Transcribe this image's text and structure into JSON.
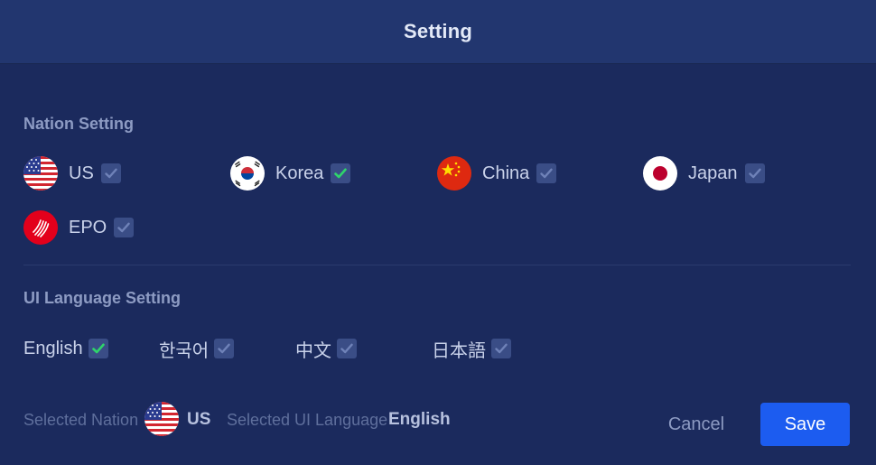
{
  "header": {
    "title": "Setting"
  },
  "nation_section": {
    "title": "Nation Setting",
    "items": [
      {
        "label": "US",
        "icon": "us-flag-icon",
        "checked": false
      },
      {
        "label": "Korea",
        "icon": "korea-flag-icon",
        "checked": true
      },
      {
        "label": "China",
        "icon": "china-flag-icon",
        "checked": false
      },
      {
        "label": "Japan",
        "icon": "japan-flag-icon",
        "checked": false
      },
      {
        "label": "EPO",
        "icon": "epo-logo-icon",
        "checked": false
      }
    ]
  },
  "language_section": {
    "title": "UI Language Setting",
    "items": [
      {
        "label": "English",
        "checked": true
      },
      {
        "label": "한국어",
        "checked": false
      },
      {
        "label": "中文",
        "checked": false
      },
      {
        "label": "日本語",
        "checked": false
      }
    ]
  },
  "footer": {
    "selected_nation_label": "Selected Nation",
    "selected_nation_value": "US",
    "selected_language_label": "Selected UI Language",
    "selected_language_value": "English",
    "cancel_label": "Cancel",
    "save_label": "Save"
  },
  "colors": {
    "background": "#1b2a5d",
    "header": "#22366f",
    "check_active": "#2fd46b",
    "check_inactive": "#6f82b8",
    "save_button": "#1c5cf0"
  }
}
